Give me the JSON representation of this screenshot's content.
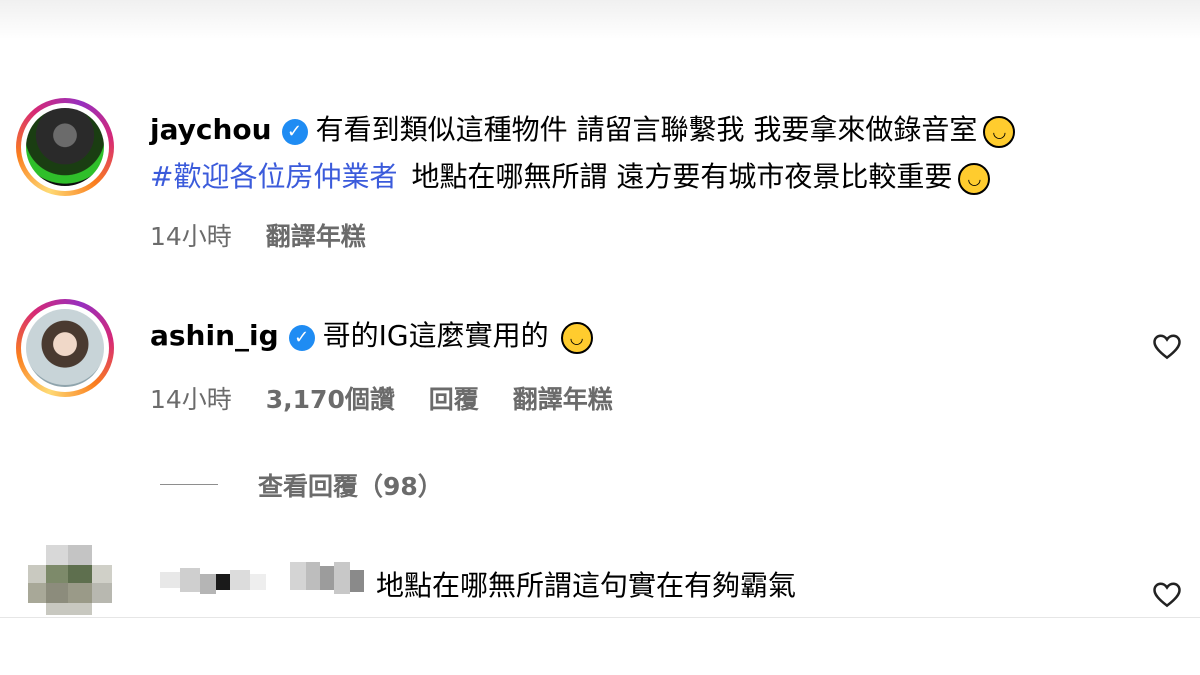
{
  "comments": [
    {
      "username": "jaychou",
      "line1": "有看到類似這種物件 請留言聯繫我 我要拿來做錄音室",
      "hashtag": "#歡迎各位房仲業者",
      "line2": "地點在哪無所謂 遠方要有城市夜景比較重要",
      "time": "14小時",
      "translate": "翻譯年糕"
    },
    {
      "username": "ashin_ig",
      "text": "哥的IG這麼實用的",
      "time": "14小時",
      "likes": "3,170個讚",
      "reply": "回覆",
      "translate": "翻譯年糕",
      "view_replies": "查看回覆（98）"
    },
    {
      "text": "地點在哪無所謂這句實在有夠霸氣"
    }
  ],
  "icons": {
    "verified": "verified-badge-icon",
    "emoji": "rolling-laughing-emoji-icon",
    "heart": "heart-outline-icon"
  },
  "colors": {
    "hashtag": "#3b5bdb",
    "verified": "#1f8cf3",
    "meta": "#6b6b6b"
  }
}
